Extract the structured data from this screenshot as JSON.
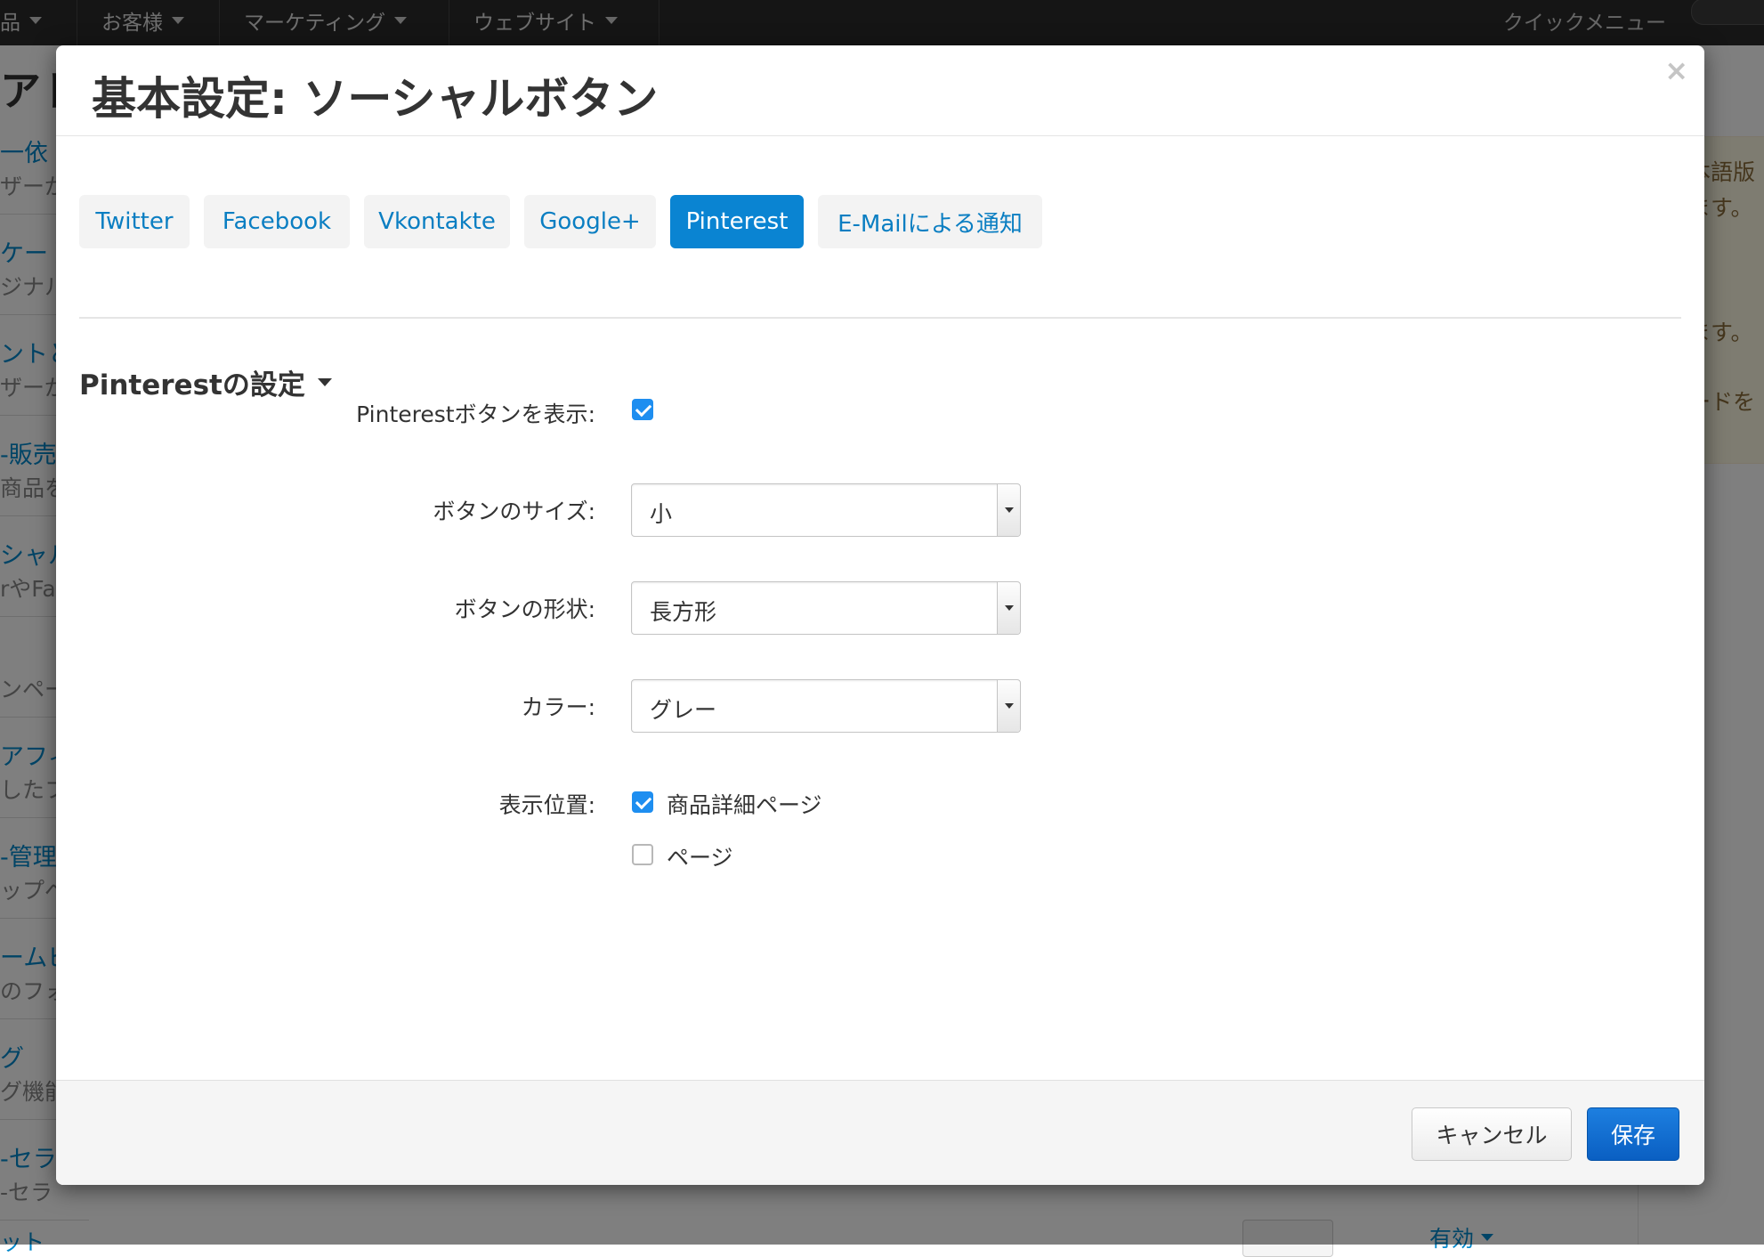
{
  "background": {
    "topnav": [
      {
        "label": "品"
      },
      {
        "label": "お客様"
      },
      {
        "label": "マーケティング"
      },
      {
        "label": "ウェブサイト"
      }
    ],
    "quick_menu": "クイックメニュー",
    "page_title": "アドオ",
    "left_items": [
      {
        "title": "一依",
        "sub": "ザーが"
      },
      {
        "title": "ケート",
        "sub": "ジナル"
      },
      {
        "title": "ントと",
        "sub": "ザーが"
      },
      {
        "title": "-販売",
        "sub": "商品を"
      },
      {
        "title": "シャル",
        "sub": "rやFa"
      },
      {
        "title": "",
        "sub": "ンペー"
      },
      {
        "title": "アフィ",
        "sub": "したフ"
      },
      {
        "title": "-管理",
        "sub": "ップペ"
      },
      {
        "title": "ームビ",
        "sub": "のフォ"
      },
      {
        "title": "グ",
        "sub": "グ機能"
      },
      {
        "title": "-セラ",
        "sub": "-セラ"
      }
    ],
    "right_notice": [
      "本語版",
      "ます。",
      "ます。",
      "ードを"
    ],
    "bottom_left": "ット",
    "bottom_status": "有効"
  },
  "modal": {
    "title": "基本設定: ソーシャルボタン",
    "close_symbol": "×",
    "tabs": [
      {
        "label": "Twitter",
        "active": false
      },
      {
        "label": "Facebook",
        "active": false
      },
      {
        "label": "Vkontakte",
        "active": false
      },
      {
        "label": "Google+",
        "active": false
      },
      {
        "label": "Pinterest",
        "active": true
      },
      {
        "label": "E-Mailによる通知",
        "active": false
      }
    ],
    "section_title": "Pinterestの設定",
    "fields": {
      "show_button": {
        "label": "Pinterestボタンを表示:",
        "checked": true
      },
      "size": {
        "label": "ボタンのサイズ:",
        "value": "小"
      },
      "shape": {
        "label": "ボタンの形状:",
        "value": "長方形"
      },
      "color": {
        "label": "カラー:",
        "value": "グレー"
      },
      "position": {
        "label": "表示位置:",
        "options": [
          {
            "label": "商品詳細ページ",
            "checked": true
          },
          {
            "label": "ページ",
            "checked": false
          }
        ]
      }
    },
    "footer": {
      "cancel": "キャンセル",
      "save": "保存"
    }
  },
  "colors": {
    "accent": "#0a84d2",
    "link": "#0a7ec2",
    "checkbox": "#1e8ef0",
    "save": "#0a5fc2"
  }
}
